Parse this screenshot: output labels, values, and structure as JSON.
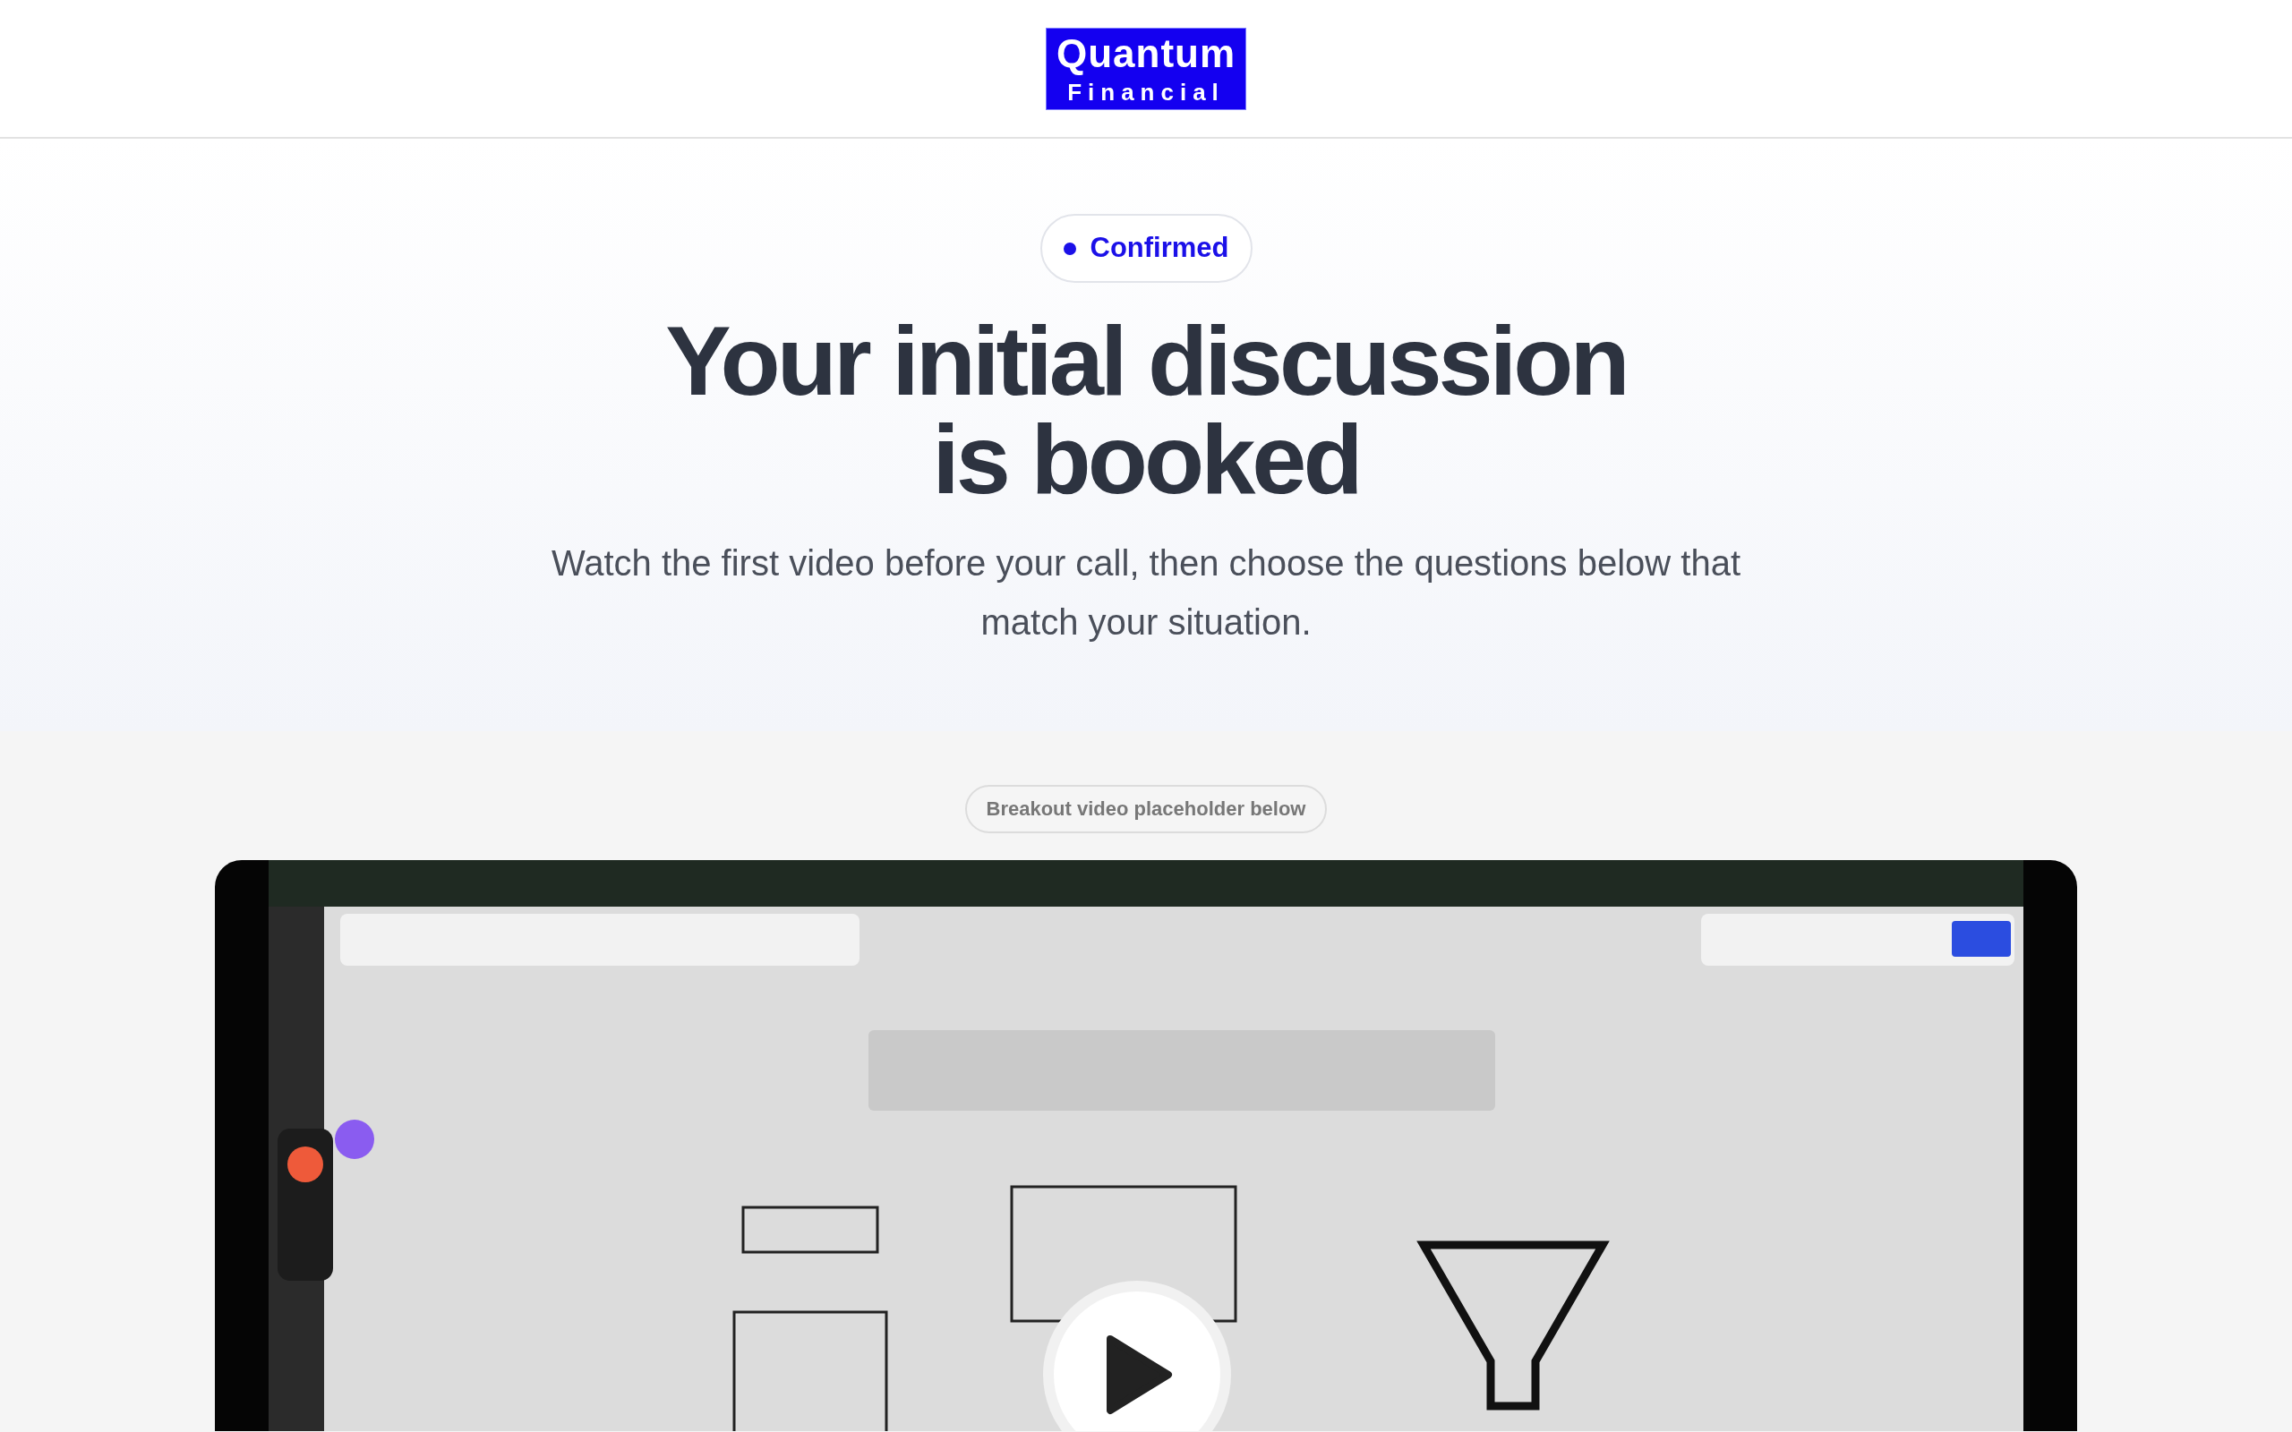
{
  "header": {
    "logo": {
      "line_1": "Quantum",
      "line_2": "Financial"
    }
  },
  "hero": {
    "status_badge": "Confirmed",
    "title_lines": [
      "Your initial discussion",
      "is booked"
    ],
    "subtitle": "Watch the first video before your call, then choose the questions below that match your situation."
  },
  "video_section": {
    "label": "Breakout video placeholder below"
  }
}
